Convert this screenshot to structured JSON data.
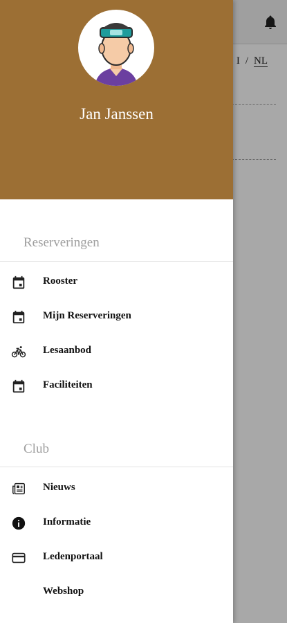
{
  "user": {
    "name": "Jan Janssen"
  },
  "background": {
    "lang_prev": "I",
    "lang_sep": "/",
    "lang_current": "NL"
  },
  "sections": {
    "reservations": {
      "title": "Reserveringen",
      "items": [
        {
          "label": "Rooster",
          "icon": "calendar-icon"
        },
        {
          "label": "Mijn Reserveringen",
          "icon": "calendar-icon"
        },
        {
          "label": "Lesaanbod",
          "icon": "bicycle-icon"
        },
        {
          "label": "Faciliteiten",
          "icon": "calendar-icon"
        }
      ]
    },
    "club": {
      "title": "Club",
      "items": [
        {
          "label": "Nieuws",
          "icon": "newspaper-icon"
        },
        {
          "label": "Informatie",
          "icon": "info-icon"
        },
        {
          "label": "Ledenportaal",
          "icon": "credit-card-icon"
        },
        {
          "label": "Webshop",
          "icon": ""
        }
      ]
    }
  },
  "colors": {
    "header": "#9c6f34",
    "scrim": "rgba(0,0,0,0.34)"
  }
}
